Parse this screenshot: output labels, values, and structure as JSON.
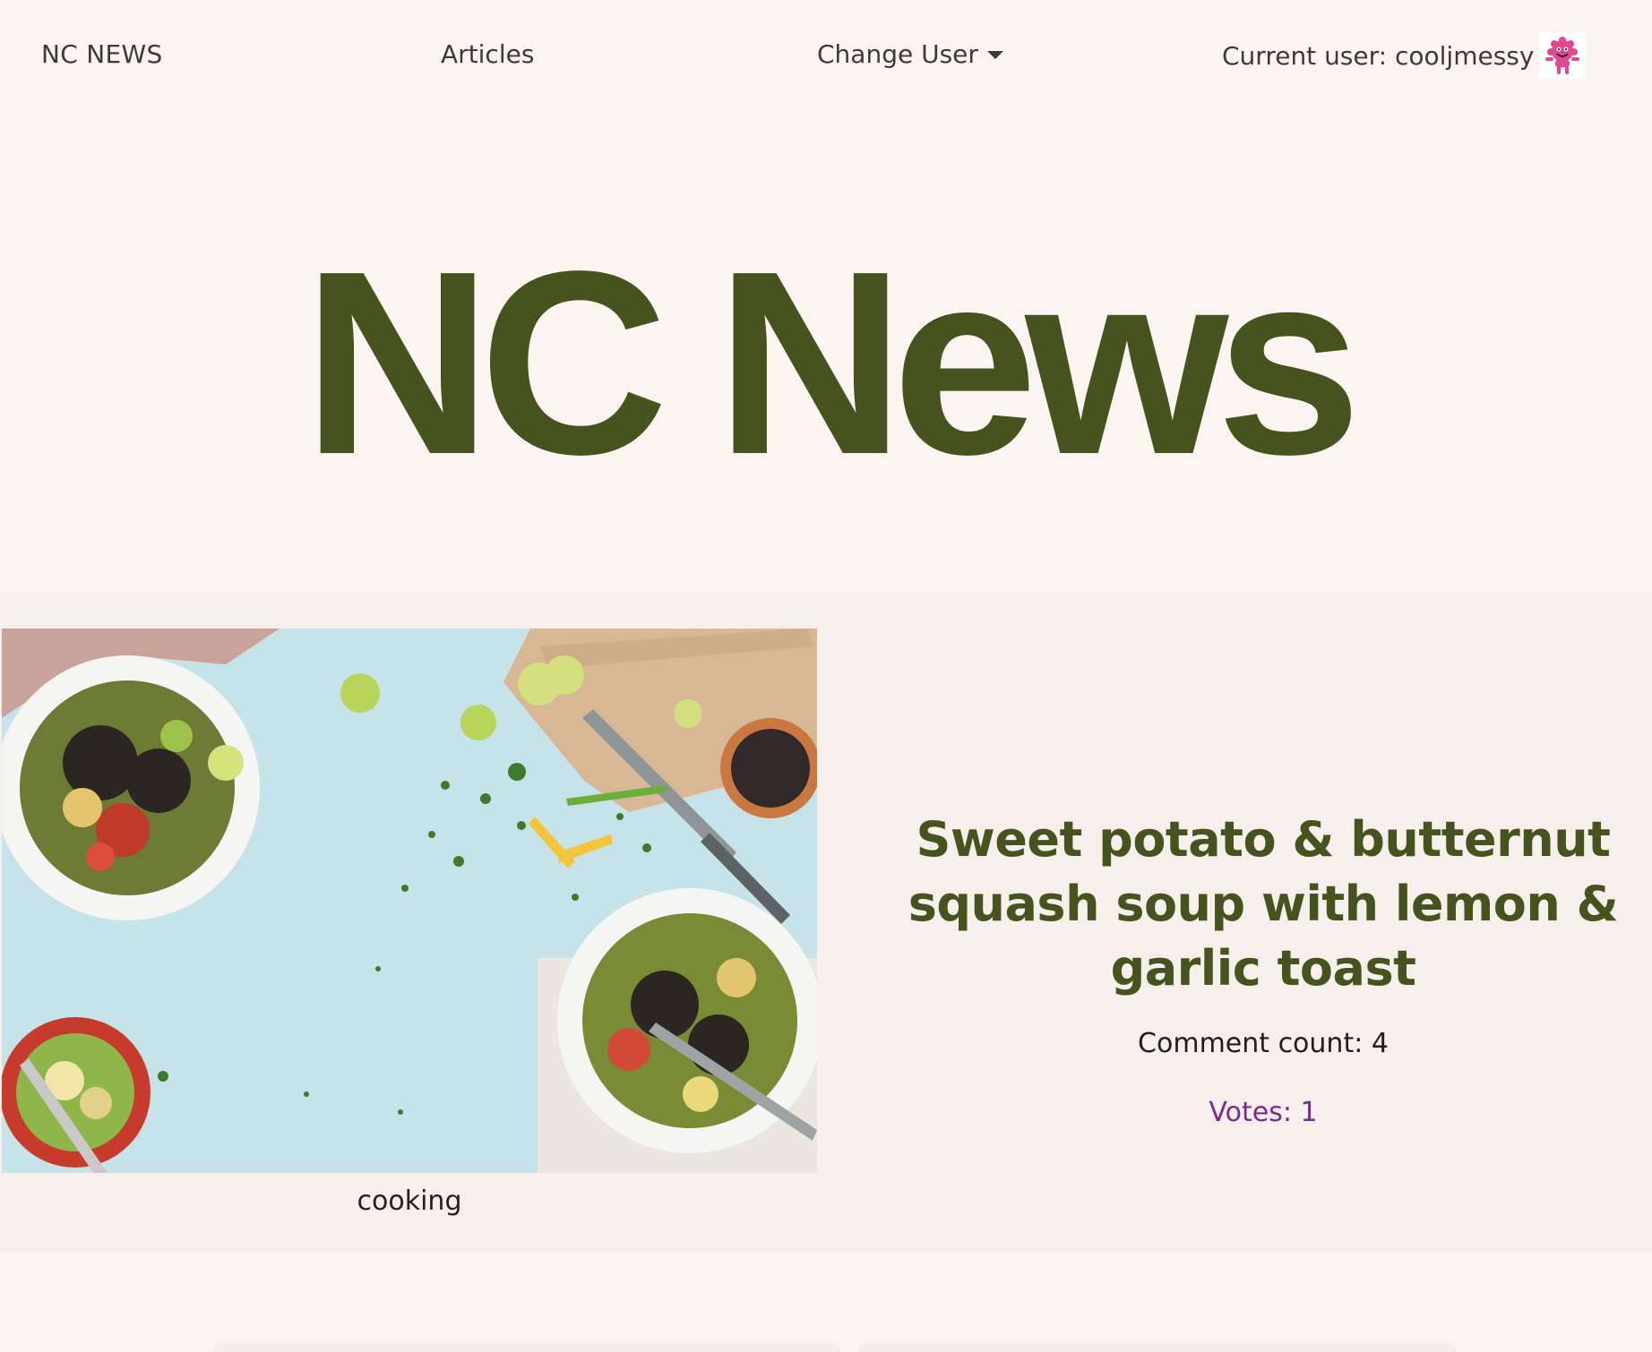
{
  "navbar": {
    "brand": "NC NEWS",
    "articles_link": "Articles",
    "change_user_label": "Change User",
    "current_user_text": "Current user: cooljmessy"
  },
  "hero": {
    "title": "NC News"
  },
  "article": {
    "title": "Sweet potato & butternut squash soup with lemon & garlic toast",
    "topic": "cooking",
    "comment_count_text": "Comment count: 4",
    "votes_text": "Votes: 1"
  },
  "colors": {
    "background": "#fcf4f1",
    "card": "#f7efec",
    "accent_green": "#46531f",
    "votes_purple": "#7b2a8f",
    "avatar_pink": "#e0488f"
  },
  "icons": {
    "dropdown": "caret-down-icon",
    "avatar": "avatar-character-icon"
  }
}
